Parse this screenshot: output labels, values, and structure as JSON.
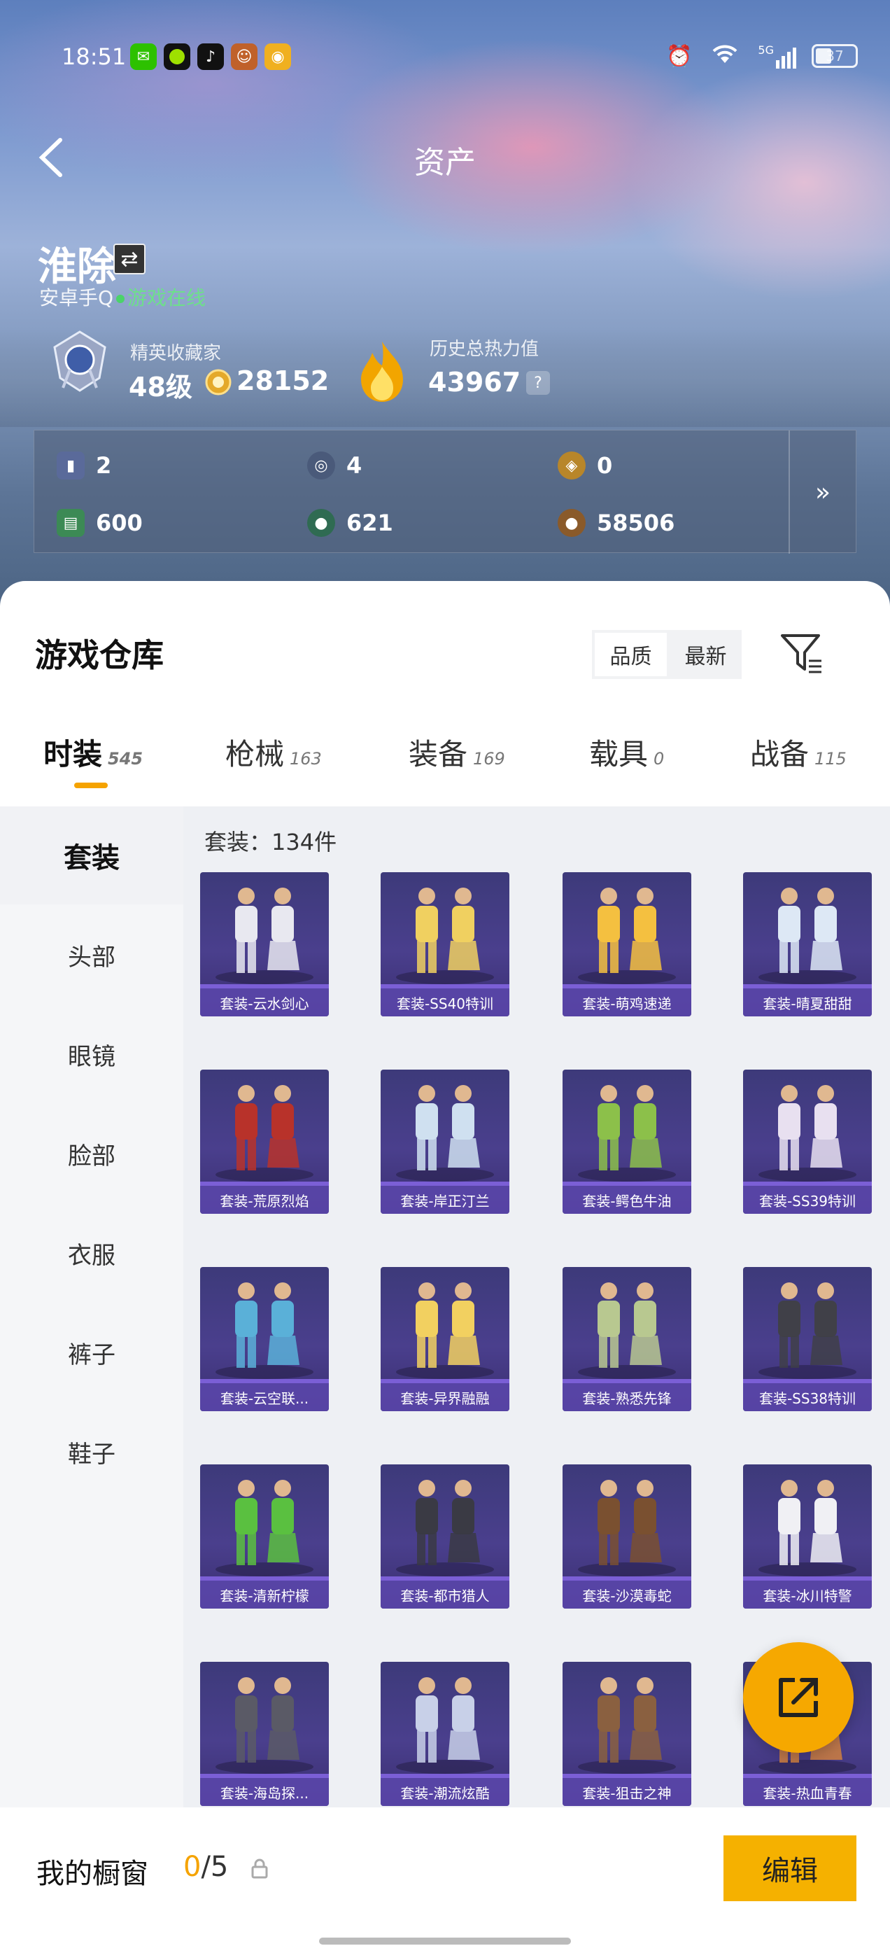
{
  "status_bar": {
    "time": "18:51",
    "network": "5G",
    "battery": "37"
  },
  "header": {
    "title": "资产",
    "back_label": "‹"
  },
  "user": {
    "name": "淮除",
    "platform_prefix": "安卓手Q",
    "online_status": "游戏在线",
    "rank_title": "精英收藏家",
    "rank_level": "48级",
    "coins": "28152",
    "heat_label": "历史总热力值",
    "heat_value": "43967",
    "help": "?"
  },
  "currencies": [
    {
      "icon": "card-icon",
      "value": "2",
      "color": "#5a6a9a"
    },
    {
      "icon": "compass-icon",
      "value": "4",
      "color": "#4a5a7a"
    },
    {
      "icon": "gold-token-icon",
      "value": "0",
      "color": "#b8862a"
    },
    {
      "icon": "green-ticket-icon",
      "value": "600",
      "color": "#3c8a55"
    },
    {
      "icon": "green-orb-icon",
      "value": "621",
      "color": "#2f6b52"
    },
    {
      "icon": "bronze-coin-icon",
      "value": "58506",
      "color": "#8a5a2a"
    }
  ],
  "panel_more": "»",
  "warehouse": {
    "title": "游戏仓库",
    "sort_options": [
      "品质",
      "最新"
    ],
    "active_sort": 1
  },
  "tabs": [
    {
      "label": "时装",
      "count": "545",
      "active": true
    },
    {
      "label": "枪械",
      "count": "163",
      "active": false
    },
    {
      "label": "装备",
      "count": "169",
      "active": false
    },
    {
      "label": "载具",
      "count": "0",
      "active": false
    },
    {
      "label": "战备",
      "count": "115",
      "active": false
    }
  ],
  "categories": [
    "套装",
    "头部",
    "眼镜",
    "脸部",
    "衣服",
    "裤子",
    "鞋子"
  ],
  "grid_title": "套装：134件",
  "items": [
    {
      "label": "套装-云水剑心",
      "palette": "#e8e8f0"
    },
    {
      "label": "套装-SS40特训",
      "palette": "#f0d060"
    },
    {
      "label": "套装-萌鸡速递",
      "palette": "#f4c040"
    },
    {
      "label": "套装-晴夏甜甜",
      "palette": "#dde8f5"
    },
    {
      "label": "套装-荒原烈焰",
      "palette": "#b8322a"
    },
    {
      "label": "套装-岸正汀兰",
      "palette": "#cfe0f0"
    },
    {
      "label": "套装-鳄色牛油",
      "palette": "#8cc04a"
    },
    {
      "label": "套装-SS39特训",
      "palette": "#e8e0f0"
    },
    {
      "label": "套装-云空联...",
      "palette": "#5ab0d8"
    },
    {
      "label": "套装-异界融融",
      "palette": "#f2d060"
    },
    {
      "label": "套装-熟悉先锋",
      "palette": "#b8c890"
    },
    {
      "label": "套装-SS38特训",
      "palette": "#404048"
    },
    {
      "label": "套装-清新柠檬",
      "palette": "#5ac040"
    },
    {
      "label": "套装-都市猎人",
      "palette": "#3a3a44"
    },
    {
      "label": "套装-沙漠毒蛇",
      "palette": "#7a5030"
    },
    {
      "label": "套装-冰川特警",
      "palette": "#f0f0f4"
    },
    {
      "label": "套装-海岛探...",
      "palette": "#5a5a66"
    },
    {
      "label": "套装-潮流炫酷",
      "palette": "#c8d0e8"
    },
    {
      "label": "套装-狙击之神",
      "palette": "#8a6040"
    },
    {
      "label": "套装-热血青春",
      "palette": "#d08040"
    }
  ],
  "bottom": {
    "showcase_label": "我的橱窗",
    "showcase_current": "0",
    "showcase_total": "/5",
    "edit_label": "编辑"
  }
}
